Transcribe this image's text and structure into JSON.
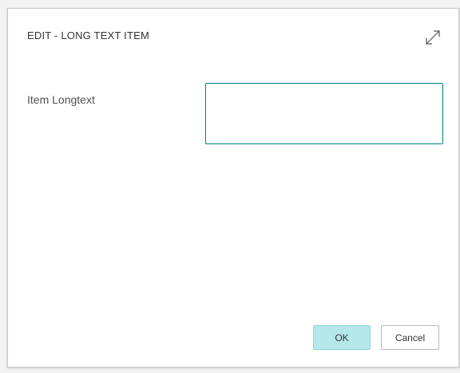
{
  "dialog": {
    "title": "EDIT - LONG TEXT ITEM",
    "expand_icon": "expand-diagonal-icon"
  },
  "form": {
    "field_label": "Item Longtext",
    "field_value": ""
  },
  "footer": {
    "ok_label": "OK",
    "cancel_label": "Cancel"
  },
  "colors": {
    "input_border": "#008080",
    "ok_background": "#b6e8ea"
  }
}
